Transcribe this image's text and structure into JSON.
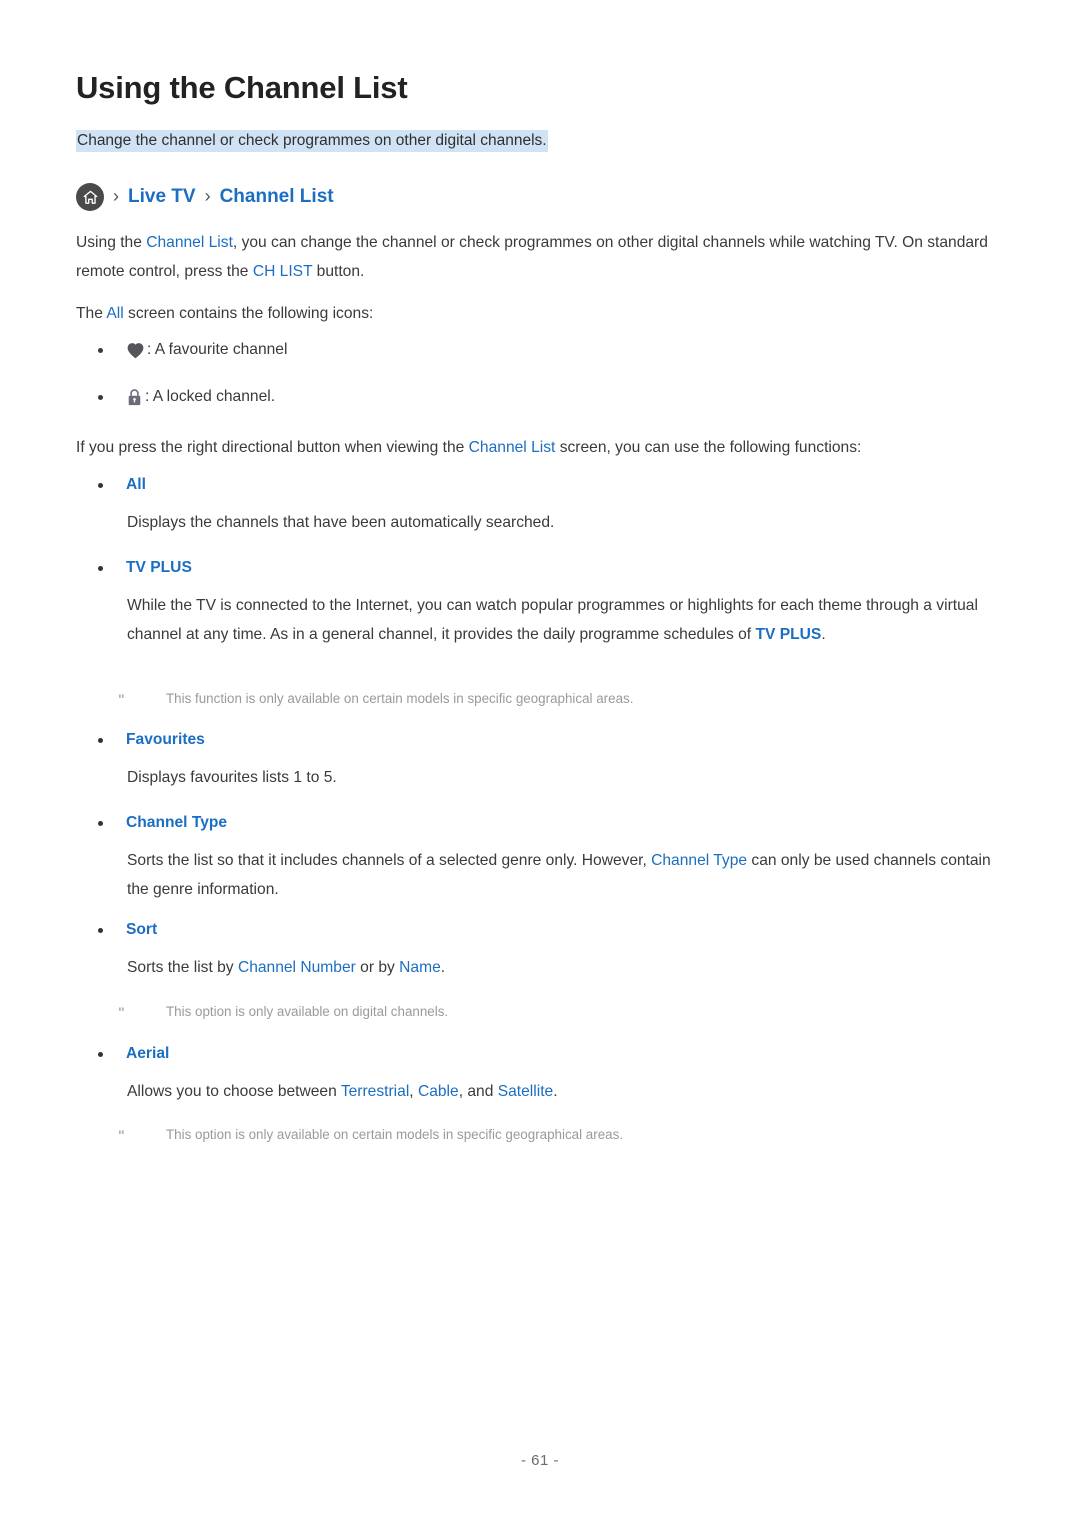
{
  "page": {
    "title": "Using the Channel List",
    "subtitle": "Change the channel or check programmes on other digital channels.",
    "page_number": "- 61 -",
    "accent_color": "#1b6ec2",
    "highlight_color": "#cfe3f4",
    "body_color": "#3a3a3a",
    "note_color": "#9a9a9a"
  },
  "breadcrumb": {
    "home_icon": "home-icon",
    "separator": "›",
    "items": [
      {
        "label": "Live TV"
      },
      {
        "label": "Channel List"
      }
    ]
  },
  "intro": {
    "p1_a": "Using the ",
    "p1_link1": "Channel List",
    "p1_b": ", you can change the channel or check programmes on other digital channels while watching TV. On standard remote control, press the ",
    "p1_link2": "CH LIST",
    "p1_c": " button.",
    "p2_a": "The ",
    "p2_link": "All",
    "p2_b": " screen contains the following icons:"
  },
  "icon_list": [
    {
      "icon": "heart-icon",
      "text": ": A favourite channel"
    },
    {
      "icon": "lock-icon",
      "text": ": A locked channel."
    }
  ],
  "functions_intro": {
    "a": "If you press the right directional button when viewing the ",
    "link": "Channel List",
    "b": " screen, you can use the following functions:"
  },
  "options": [
    {
      "name": "All",
      "desc_a": "Displays the channels that have been automatically searched.",
      "notes": []
    },
    {
      "name": "TV PLUS",
      "desc_a": "While the TV is connected to the Internet, you can watch popular programmes or highlights for each theme through a virtual channel at any time. As in a general channel, it provides the daily programme schedules of ",
      "desc_link": "TV PLUS",
      "desc_b": ".",
      "notes": [
        "This function is only available on certain models in specific geographical areas."
      ]
    },
    {
      "name": "Favourites",
      "desc_a": "Displays favourites lists 1 to 5.",
      "notes": []
    },
    {
      "name": "Channel Type",
      "desc_a": "Sorts the list so that it includes channels of a selected genre only. However, ",
      "desc_link": "Channel Type",
      "desc_b": " can only be used channels contain the genre information.",
      "notes": []
    },
    {
      "name": "Sort",
      "desc_a": "Sorts the list by ",
      "desc_link": "Channel Number",
      "desc_mid": " or by ",
      "desc_link2": "Name",
      "desc_b": ".",
      "notes": [
        "This option is only available on digital channels."
      ]
    },
    {
      "name": "Aerial",
      "desc_a": "Allows you to choose between ",
      "desc_link": "Terrestrial",
      "desc_mid": ", ",
      "desc_link2": "Cable",
      "desc_mid2": ", and ",
      "desc_link3": "Satellite",
      "desc_b": ".",
      "notes": [
        "This option is only available on certain models in specific geographical areas."
      ]
    }
  ],
  "note_marker": "\""
}
